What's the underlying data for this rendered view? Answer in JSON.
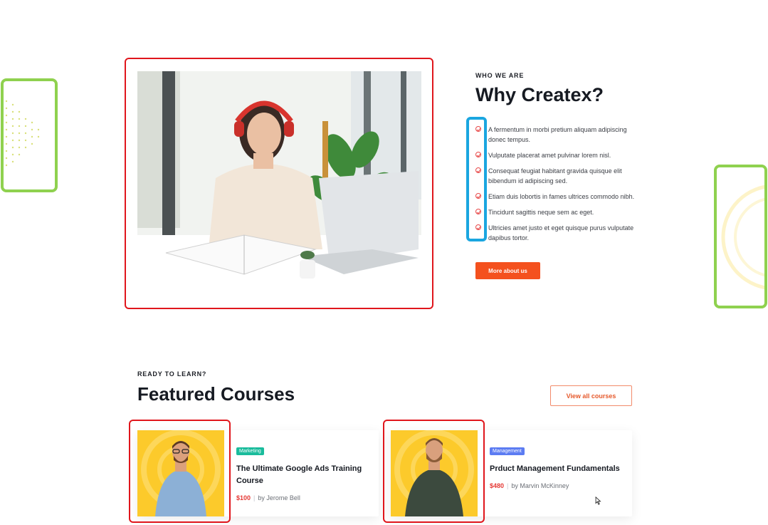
{
  "about": {
    "eyebrow": "WHO WE ARE",
    "title": "Why Createx?",
    "features": [
      "A fermentum in morbi pretium aliquam adipiscing donec tempus.",
      "Vulputate placerat amet pulvinar lorem nisl.",
      "Consequat feugiat habitant gravida quisque elit bibendum id adipiscing sed.",
      "Etiam duis lobortis in fames ultrices commodo nibh.",
      "Tincidunt sagittis neque sem ac eget.",
      "Ultricies amet justo et eget quisque purus vulputate dapibus tortor."
    ],
    "cta_label": "More about us"
  },
  "courses": {
    "eyebrow": "READY TO LEARN?",
    "title": "Featured Courses",
    "view_all_label": "View all courses",
    "items": [
      {
        "category": "Marketing",
        "category_color": "#1abc9c",
        "title": "The Ultimate Google Ads Training Course",
        "price": "$100",
        "author": "by Jerome Bell"
      },
      {
        "category": "Management",
        "category_color": "#5c7cf2",
        "title": "Prduct Management Fundamentals",
        "price": "$480",
        "author": "by Marvin McKinney"
      }
    ]
  },
  "colors": {
    "accent": "#f4511e",
    "annotation_red": "#e0161c",
    "annotation_green": "#8fd14f",
    "annotation_blue": "#1aa6e0"
  }
}
